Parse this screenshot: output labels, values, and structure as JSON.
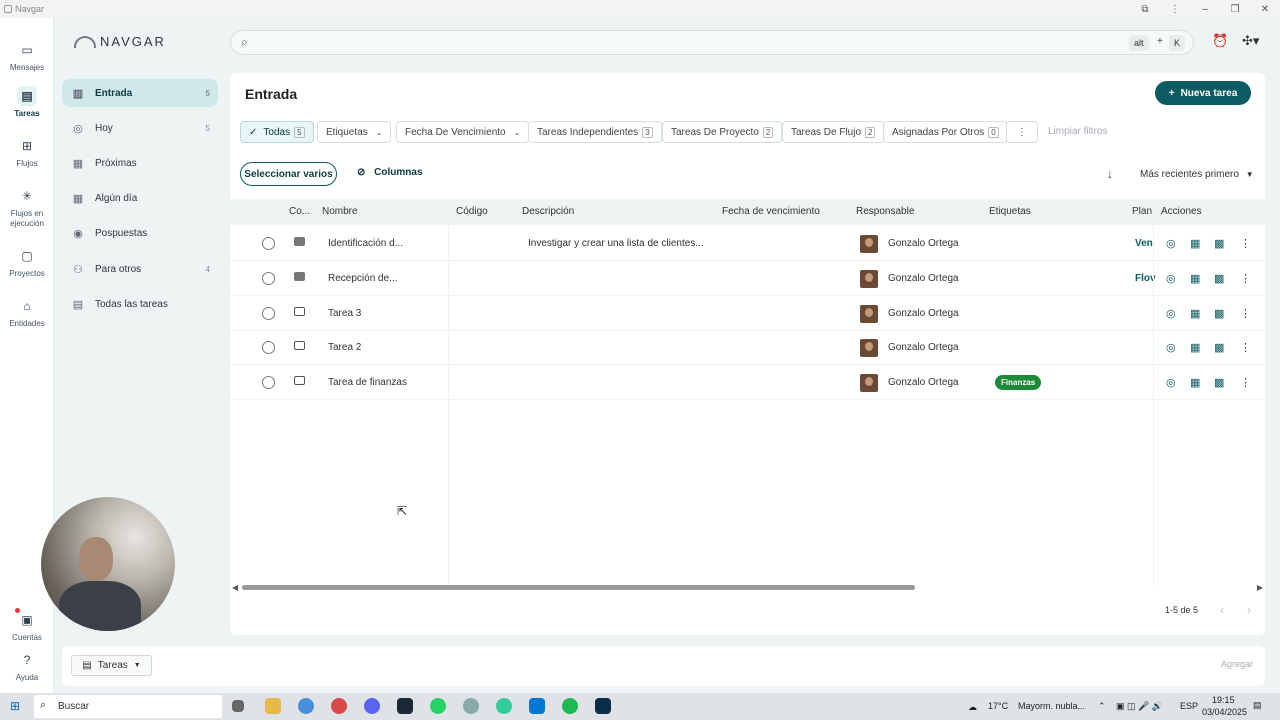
{
  "window": {
    "title": "Navgar"
  },
  "rail": {
    "items": [
      {
        "label": "Mensajes",
        "icon": "message-icon"
      },
      {
        "label": "Tareas",
        "icon": "tasks-icon",
        "active": true
      },
      {
        "label": "Flujos",
        "icon": "flows-icon"
      },
      {
        "label": "Flujos en ejecución",
        "icon": "running-flows-icon"
      },
      {
        "label": "Proyectos",
        "icon": "folder-icon"
      },
      {
        "label": "Entidades",
        "icon": "entities-icon"
      }
    ],
    "bottom": [
      {
        "label": "Cuentas",
        "icon": "accounts-icon"
      },
      {
        "label": "Ayuda",
        "icon": "help-icon"
      }
    ]
  },
  "brand": {
    "name": "NAVGAR"
  },
  "nav": {
    "items": [
      {
        "label": "Entrada",
        "count": "5",
        "icon": "inbox-icon",
        "active": true
      },
      {
        "label": "Hoy",
        "count": "5",
        "icon": "today-icon"
      },
      {
        "label": "Próximas",
        "count": "",
        "icon": "calendar-icon"
      },
      {
        "label": "Algún día",
        "count": "",
        "icon": "someday-icon"
      },
      {
        "label": "Pospuestas",
        "count": "",
        "icon": "postponed-icon"
      },
      {
        "label": "Para otros",
        "count": "4",
        "icon": "person-icon"
      },
      {
        "label": "Todas las tareas",
        "count": "",
        "icon": "all-tasks-icon"
      }
    ]
  },
  "search": {
    "placeholder": "",
    "shortcut_key1": "alt",
    "shortcut_plus": "+",
    "shortcut_key2": "K"
  },
  "main": {
    "title": "Entrada",
    "new_task_label": "Nueva tarea",
    "filters": [
      {
        "label": "Todas",
        "count": "5",
        "active": true
      },
      {
        "label": "Etiquetas",
        "count": "",
        "dropdown": true
      },
      {
        "label": "Fecha De Vencimiento",
        "count": "",
        "dropdown": true
      },
      {
        "label": "Tareas Independientes",
        "count": "3"
      },
      {
        "label": "Tareas De Proyecto",
        "count": "2"
      },
      {
        "label": "Tareas De Flujo",
        "count": "2"
      },
      {
        "label": "Asignadas Por Otros",
        "count": "0"
      }
    ],
    "clear_filters": "Limpiar filtros",
    "select_many": "Seleccionar varios",
    "columns_label": "Columnas",
    "sort_label": "Más recientes primero",
    "columns": [
      "Co...",
      "Nombre",
      "Código",
      "Descripción",
      "Fecha de vencimiento",
      "Responsable",
      "Etiquetas",
      "Plan",
      "Acciones"
    ],
    "rows": [
      {
        "name": "Identificación d...",
        "code": "",
        "description": "Investigar y crear una lista de clientes...",
        "due": "",
        "owner": "Gonzalo Ortega",
        "tag": "",
        "plan": "Ven",
        "bubble": "filled"
      },
      {
        "name": "Recepción de...",
        "code": "",
        "description": "",
        "due": "",
        "owner": "Gonzalo Ortega",
        "tag": "",
        "plan": "Flov",
        "bubble": "filled"
      },
      {
        "name": "Tarea 3",
        "code": "",
        "description": "",
        "due": "",
        "owner": "Gonzalo Ortega",
        "tag": "",
        "plan": "",
        "bubble": "outline"
      },
      {
        "name": "Tarea 2",
        "code": "",
        "description": "",
        "due": "",
        "owner": "Gonzalo Ortega",
        "tag": "",
        "plan": "",
        "bubble": "outline"
      },
      {
        "name": "Tarea de finanzas",
        "code": "",
        "description": "",
        "due": "",
        "owner": "Gonzalo Ortega",
        "tag": "Finanzas",
        "plan": "",
        "bubble": "outline"
      }
    ],
    "pagination": "1-5 de 5"
  },
  "bottom": {
    "chip_label": "Tareas",
    "agregar": "Agregar"
  },
  "taskbar": {
    "search": "Buscar",
    "weather": "17°C",
    "weather_desc": "Mayorm. nubla...",
    "lang": "ESP",
    "time": "19:15",
    "date": "03/04/2025"
  },
  "colors": {
    "accent": "#0c5b62",
    "tag_green": "#1d8a3a"
  }
}
